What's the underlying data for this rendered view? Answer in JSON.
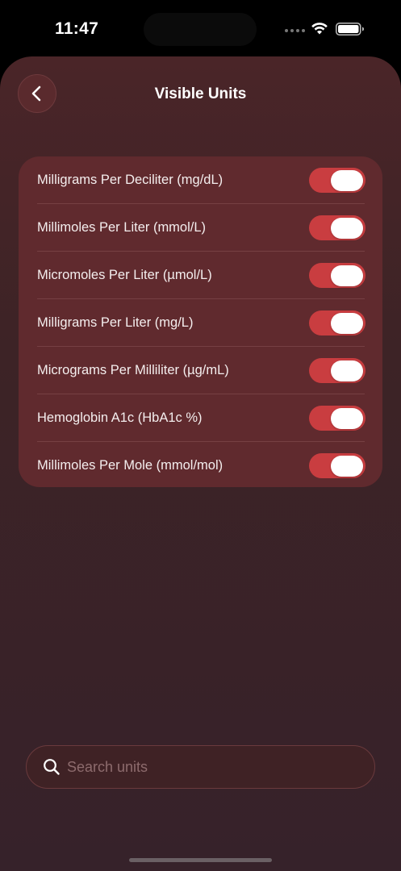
{
  "status_bar": {
    "time": "11:47"
  },
  "header": {
    "title": "Visible Units",
    "back_icon": "chevron-left-icon"
  },
  "units": [
    {
      "label": "Milligrams Per Deciliter (mg/dL)",
      "enabled": true
    },
    {
      "label": "Millimoles Per Liter (mmol/L)",
      "enabled": true
    },
    {
      "label": "Micromoles Per Liter (µmol/L)",
      "enabled": true
    },
    {
      "label": "Milligrams Per Liter (mg/L)",
      "enabled": true
    },
    {
      "label": "Micrograms Per Milliliter (µg/mL)",
      "enabled": true
    },
    {
      "label": "Hemoglobin A1c (HbA1c %)",
      "enabled": true
    },
    {
      "label": "Millimoles Per Mole (mmol/mol)",
      "enabled": true
    }
  ],
  "search": {
    "placeholder": "Search units",
    "value": "",
    "icon": "search-icon"
  },
  "colors": {
    "accent": "#c93d40",
    "sheet_background": "#3d2326",
    "card_background": "#602a2e"
  }
}
